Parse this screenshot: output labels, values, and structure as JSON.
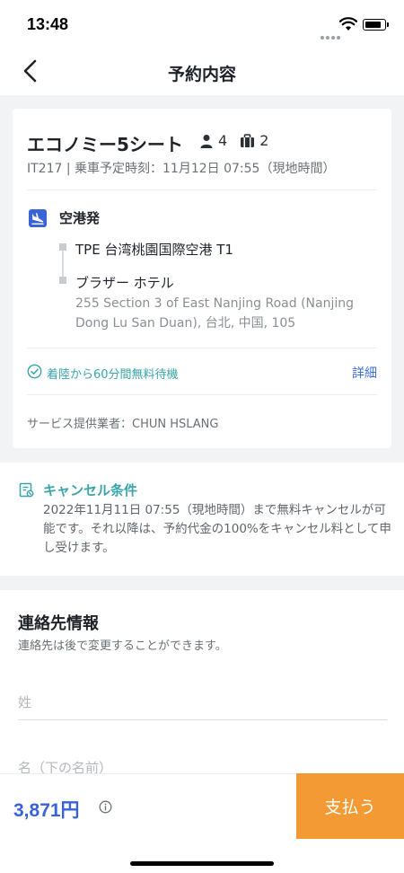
{
  "status_bar": {
    "time": "13:48"
  },
  "nav": {
    "title": "予約内容"
  },
  "booking": {
    "product_name": "エコノミー5シート",
    "passengers": "4",
    "luggage": "2",
    "trip_info": "IT217 | 乗車予定時刻：11月12日 07:55（現地時間）",
    "route_heading": "空港発",
    "pickup": "TPE 台湾桃園国際空港 T1",
    "dropoff_name": "ブラザー ホテル",
    "dropoff_address": "255 Section 3 of East Nanjing Road (Nanjing Dong Lu San Duan), 台北, 中国, 105",
    "free_wait": "着陸から60分間無料待機",
    "details_label": "詳細",
    "provider": "サービス提供業者：CHUN HSLANG"
  },
  "cancellation": {
    "title": "キャンセル条件",
    "text": "2022年11月11日 07:55（現地時間）まで無料キャンセルが可能です。それ以降は、予約代金の100%をキャンセル料として申し受けます。"
  },
  "contact": {
    "title": "連絡先情報",
    "subtitle": "連絡先は後で変更することができます。",
    "last_name_placeholder": "姓",
    "first_name_placeholder": "名（下の名前）"
  },
  "footer": {
    "price": "3,871円",
    "pay_label": "支払う"
  },
  "colors": {
    "accent_blue": "#3a63d8",
    "teal": "#3aa4a8",
    "pay_orange": "#f39a34"
  },
  "icons": [
    "back-icon",
    "person-icon",
    "luggage-icon",
    "airplane-arrival-icon",
    "check-circle-icon",
    "cancellation-policy-icon",
    "info-icon",
    "wifi-icon",
    "battery-icon"
  ]
}
